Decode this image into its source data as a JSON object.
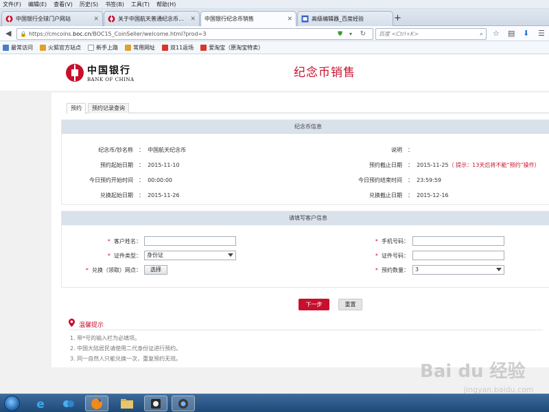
{
  "menubar": {
    "items": [
      "文件(F)",
      "编辑(E)",
      "查看(V)",
      "历史(S)",
      "书签(B)",
      "工具(T)",
      "帮助(H)"
    ]
  },
  "tabs": [
    {
      "label": "中国银行全球门户网站",
      "active": false
    },
    {
      "label": "关于中国航天普通纪念币...",
      "active": false
    },
    {
      "label": "中国银行纪念币销售",
      "active": true
    },
    {
      "label": "高级编辑器_百度经验",
      "active": false
    }
  ],
  "navbar": {
    "url_prefix": "https://cmcoins.",
    "url_host": "boc.cn",
    "url_suffix": "/BOC15_CoinSeller/welcome.html?prod=3",
    "search_placeholder": "百度 <Ctrl+K>"
  },
  "bookmarks": [
    {
      "label": "最常访问",
      "color": "#4a7ec2"
    },
    {
      "label": "火狐官方站点",
      "color": "#e0a030"
    },
    {
      "label": "新手上路",
      "color": "#ffffff"
    },
    {
      "label": "常用网址",
      "color": "#e0a030"
    },
    {
      "label": "双11返场",
      "color": "#d9362b"
    },
    {
      "label": "爱淘宝（原淘宝特卖）",
      "color": "#d9362b"
    }
  ],
  "header": {
    "bank_name_cn": "中国银行",
    "bank_name_en": "BANK OF CHINA",
    "page_title": "纪念币销售"
  },
  "page_tabs": [
    "预约",
    "预约记录查询"
  ],
  "coin_info": {
    "section_title": "纪念币信息",
    "left": [
      {
        "label": "纪念币/钞名称",
        "value": "中国航天纪念币"
      },
      {
        "label": "预约起始日期",
        "value": "2015-11-10"
      },
      {
        "label": "今日预约开始时间",
        "value": "00:00:00"
      },
      {
        "label": "兑换起始日期",
        "value": "2015-11-26"
      }
    ],
    "right": [
      {
        "label": "说明",
        "value": ""
      },
      {
        "label": "预约截止日期",
        "value": "2015-11-25"
      },
      {
        "label": "今日预约结束时间",
        "value": "23:59:59"
      },
      {
        "label": "兑换截止日期",
        "value": "2015-12-16"
      }
    ],
    "deadline_hint": "（ 提示：13天后将不能“预约”操作）"
  },
  "customer_info": {
    "section_title": "请填写客户信息",
    "name_label": "客户姓名",
    "name_value": "",
    "id_type_label": "证件类型",
    "id_type_value": "身份证",
    "branch_label": "兑换（领取）网点",
    "choose_button": "选择",
    "phone_label": "手机号码",
    "phone_value": "",
    "id_no_label": "证件号码",
    "id_no_value": "",
    "qty_label": "预约数量",
    "qty_value": "3",
    "required_mark": "*",
    "colon": "："
  },
  "actions": {
    "next": "下一步",
    "reset": "重置"
  },
  "tips": {
    "title": "温馨提示",
    "items": [
      "1. 带*号的输入栏为必填项。",
      "2. 中国大陆居民请使用二代身份证进行预约。",
      "3. 同一自然人只能兑换一次，重复预约无效。"
    ]
  },
  "watermark": {
    "brand": "Bai du 经验",
    "url": "jingyan.baidu.com"
  },
  "colors": {
    "brand_red": "#c8102e",
    "section_header": "#d9e1ea",
    "taskbar": "#1f4a78"
  }
}
